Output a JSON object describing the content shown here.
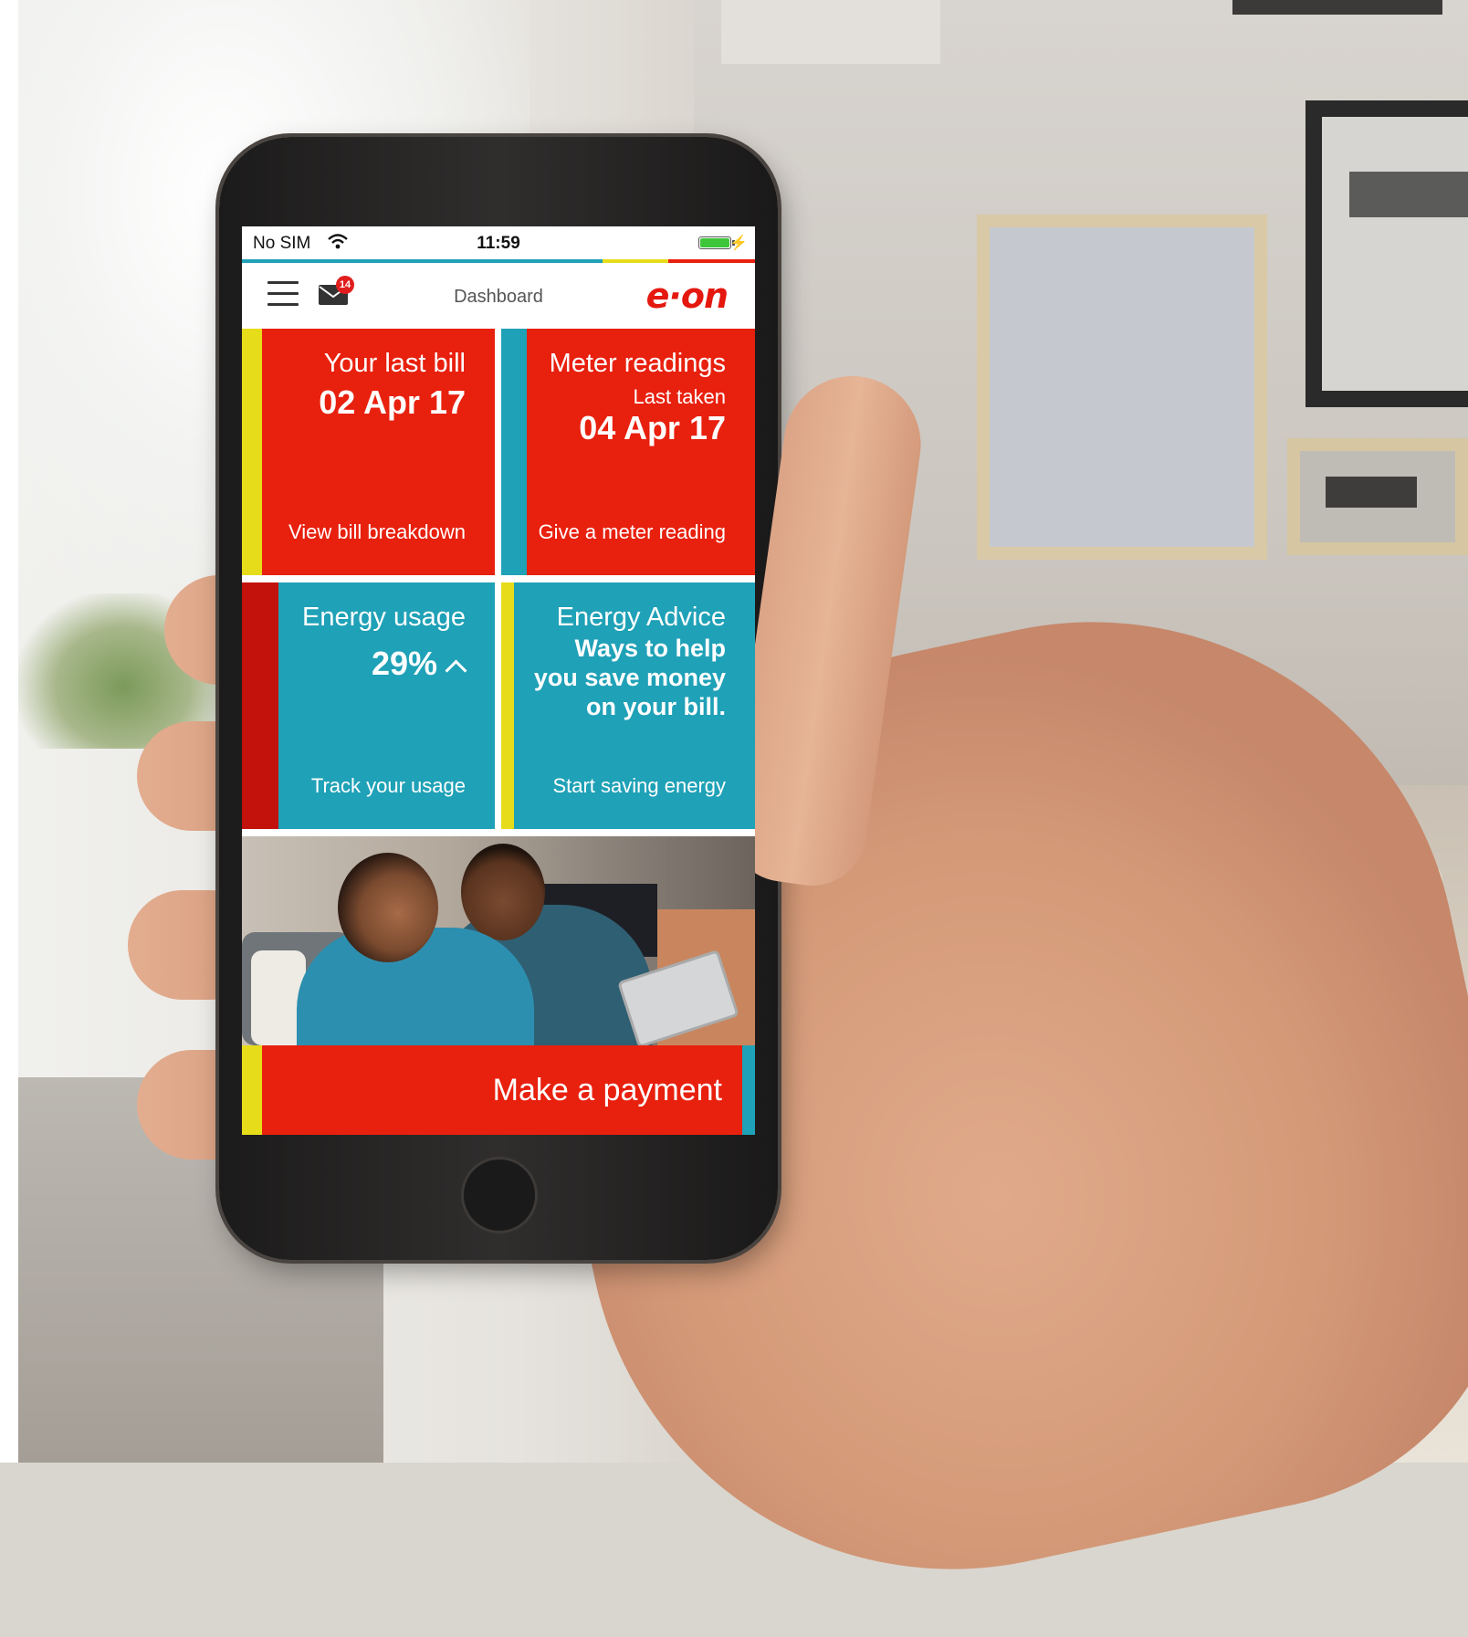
{
  "status_bar": {
    "carrier": "No SIM",
    "time": "11:59",
    "wifi_icon": "wifi-icon",
    "battery_icon": "battery-icon",
    "battery_level": 1.0
  },
  "accent_colors": {
    "red": "#e8200e",
    "teal": "#1fa1b7",
    "yellow": "#e7dc1a",
    "dark_red": "#c3110c"
  },
  "nav": {
    "menu_icon": "hamburger-menu-icon",
    "mail_icon": "mail-icon",
    "mail_badge": "14",
    "title": "Dashboard",
    "logo": "e·on"
  },
  "tiles": {
    "last_bill": {
      "title": "Your last bill",
      "date": "02 Apr 17",
      "link": "View bill breakdown"
    },
    "meter": {
      "title": "Meter readings",
      "subtitle": "Last taken",
      "date": "04 Apr 17",
      "link": "Give a meter reading"
    },
    "usage": {
      "title": "Energy usage",
      "value": "29%",
      "trend_icon": "arrow-up-icon",
      "link": "Track your usage"
    },
    "advice": {
      "title": "Energy Advice",
      "line1": "Ways to help",
      "line2": "you save money",
      "line3": "on your bill.",
      "link": "Start saving energy"
    }
  },
  "payment": {
    "label": "Make a payment"
  }
}
